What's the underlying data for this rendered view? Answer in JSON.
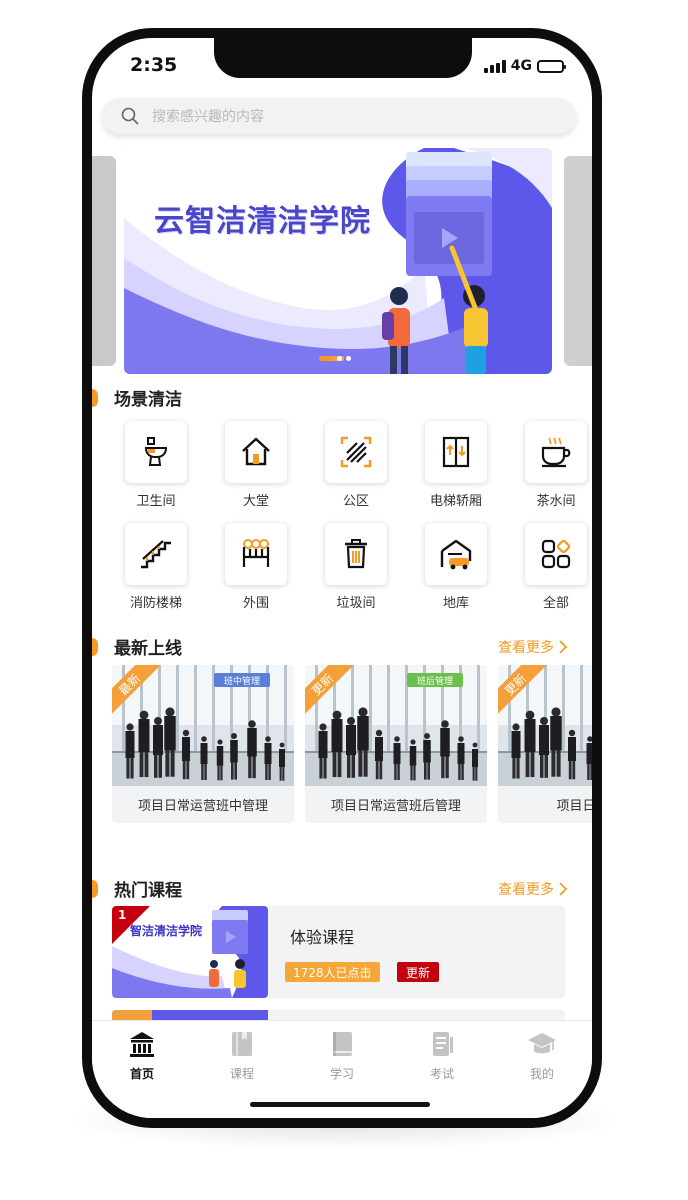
{
  "status": {
    "time": "2:35",
    "network": "4G",
    "battery_level": 0.8
  },
  "search": {
    "placeholder": "搜索感兴趣的内容"
  },
  "banner": {
    "title": "云智洁清洁学院",
    "slide_count": 3,
    "active_slide": 1
  },
  "scene_section": {
    "title": "场景清洁"
  },
  "categories": [
    {
      "label": "卫生间",
      "icon": "toilet-icon"
    },
    {
      "label": "大堂",
      "icon": "house-icon"
    },
    {
      "label": "公区",
      "icon": "area-icon"
    },
    {
      "label": "电梯轿厢",
      "icon": "elevator-icon"
    },
    {
      "label": "茶水间",
      "icon": "teacup-icon"
    },
    {
      "label": "消防楼梯",
      "icon": "stairs-icon"
    },
    {
      "label": "外围",
      "icon": "fence-icon"
    },
    {
      "label": "垃圾间",
      "icon": "trash-icon"
    },
    {
      "label": "地库",
      "icon": "garage-icon"
    },
    {
      "label": "全部",
      "icon": "grid-all-icon"
    }
  ],
  "latest_section": {
    "title": "最新上线",
    "more": "查看更多"
  },
  "latest_courses": [
    {
      "title": "项目日常运营班中管理",
      "ribbon": "最新",
      "tag": "班中管理",
      "tag_color": "#5b7fd6"
    },
    {
      "title": "项目日常运营班后管理",
      "ribbon": "更新",
      "tag": "班后管理",
      "tag_color": "#6cbf4d"
    },
    {
      "title": "项目日常运",
      "ribbon": "更新",
      "tag": "",
      "tag_color": "#5b7fd6"
    }
  ],
  "hot_section": {
    "title": "热门课程",
    "more": "查看更多"
  },
  "hot_courses": [
    {
      "rank": "1",
      "thumb_title": "智洁清洁学院",
      "title": "体验课程",
      "clicks": "1728人已点击",
      "badge": "更新"
    }
  ],
  "tabs": [
    {
      "label": "首页",
      "icon": "bank-icon",
      "active": true
    },
    {
      "label": "课程",
      "icon": "book-icon",
      "active": false
    },
    {
      "label": "学习",
      "icon": "notebook-icon",
      "active": false
    },
    {
      "label": "考试",
      "icon": "exam-icon",
      "active": false
    },
    {
      "label": "我的",
      "icon": "graduation-cap-icon",
      "active": false
    }
  ],
  "colors": {
    "accent": "#f59a23",
    "brand": "#5a53e6",
    "badge_red": "#c4000e"
  }
}
